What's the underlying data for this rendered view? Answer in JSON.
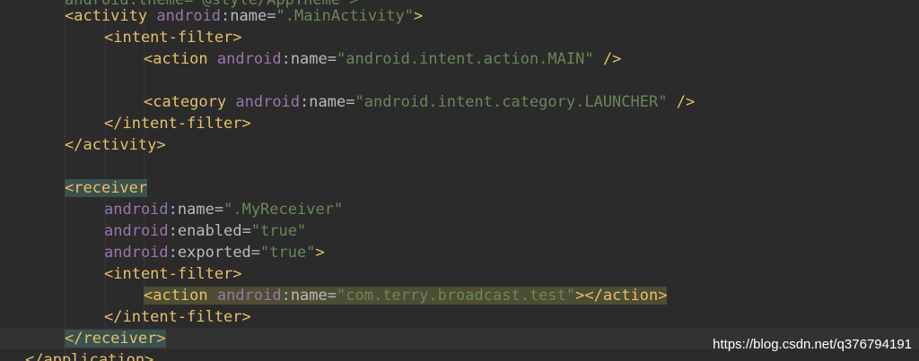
{
  "lines": {
    "l0": {
      "partial": "android:theme=\"@style/AppTheme\">"
    },
    "l1": {
      "open": "<activity",
      "ns": "android",
      "colon": ":",
      "attr": "name",
      "eq": "=",
      "val": "\".MainActivity\"",
      "close": ">"
    },
    "l2": {
      "tag": "<intent-filter>"
    },
    "l3": {
      "open": "<action",
      "ns": "android",
      "colon": ":",
      "attr": "name",
      "eq": "=",
      "val": "\"android.intent.action.MAIN\"",
      "close": " />"
    },
    "l5": {
      "open": "<category",
      "ns": "android",
      "colon": ":",
      "attr": "name",
      "eq": "=",
      "val": "\"android.intent.category.LAUNCHER\"",
      "close": " />"
    },
    "l6": {
      "tag": "</intent-filter>"
    },
    "l7": {
      "tag": "</activity>"
    },
    "l9": {
      "lt": "<",
      "name": "receiver"
    },
    "l10": {
      "ns": "android",
      "colon": ":",
      "attr": "name",
      "eq": "=",
      "val": "\".MyReceiver\""
    },
    "l11": {
      "ns": "android",
      "colon": ":",
      "attr": "enabled",
      "eq": "=",
      "val": "\"true\""
    },
    "l12": {
      "ns": "android",
      "colon": ":",
      "attr": "exported",
      "eq": "=",
      "val": "\"true\"",
      "close": ">"
    },
    "l13": {
      "tag": "<intent-filter>"
    },
    "l14": {
      "open": "<action",
      "ns": "android",
      "colon": ":",
      "attr": "name",
      "eq": "=",
      "val": "\"com.terry.broadcast.test\"",
      "close": "></action>"
    },
    "l15": {
      "tag": "</intent-filter>"
    },
    "l16": {
      "tag": "</receiver>"
    },
    "l17": {
      "tag": "</application>"
    }
  },
  "watermark": "https://blog.csdn.net/q376794191",
  "colors": {
    "background": "#2b2b2b",
    "tag": "#e8bf6a",
    "namespace": "#9876aa",
    "attribute": "#bababa",
    "string": "#6a8759",
    "text": "#a9b7c6"
  }
}
